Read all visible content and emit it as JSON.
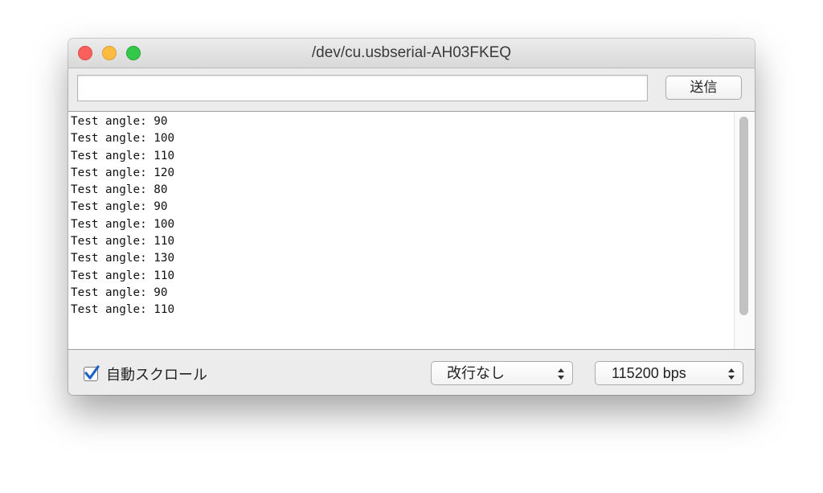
{
  "window": {
    "title": "/dev/cu.usbserial-AH03FKEQ"
  },
  "input": {
    "value": "",
    "placeholder": ""
  },
  "send_button": {
    "label": "送信"
  },
  "output": {
    "lines": [
      "Test angle: 90",
      "Test angle: 100",
      "Test angle: 110",
      "Test angle: 120",
      "Test angle: 80",
      "Test angle: 90",
      "Test angle: 100",
      "Test angle: 110",
      "Test angle: 130",
      "Test angle: 110",
      "Test angle: 90",
      "Test angle: 110"
    ]
  },
  "footer": {
    "autoscroll_label": "自動スクロール",
    "autoscroll_checked": true,
    "line_ending": "改行なし",
    "baud_rate": "115200 bps"
  },
  "colors": {
    "close": "#fc605c",
    "minimize": "#fdbc40",
    "zoom": "#34c84a",
    "checkbox_check": "#1d62c7"
  },
  "icons": {
    "close": "close-icon",
    "minimize": "minimize-icon",
    "zoom": "zoom-icon",
    "checkmark": "checkmark-icon",
    "select_arrows": "up-down-arrows-icon"
  }
}
